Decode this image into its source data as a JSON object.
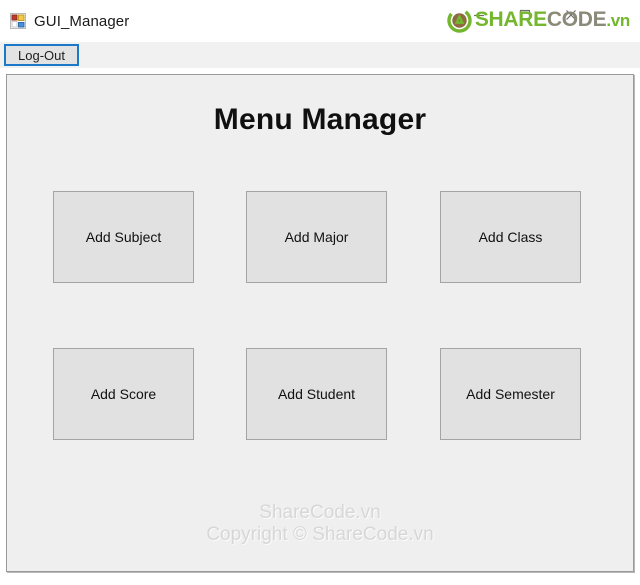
{
  "window": {
    "title": "GUI_Manager",
    "app_icon": "windows-forms-icon",
    "controls": {
      "minimize": "minimize-icon",
      "maximize": "maximize-icon",
      "close": "close-icon"
    }
  },
  "menustrip": {
    "logout_label": "Log-Out"
  },
  "branding": {
    "logo_mark": "sharecode-recycle-logo-icon",
    "text_share": "SHARE",
    "text_code": "CODE",
    "text_vn": ".vn",
    "color_green": "#74b72e",
    "color_gray": "#8a8a7a"
  },
  "main": {
    "heading": "Menu Manager",
    "buttons": [
      {
        "label": "Add Subject"
      },
      {
        "label": "Add Major"
      },
      {
        "label": "Add Class"
      },
      {
        "label": "Add Score"
      },
      {
        "label": "Add Student"
      },
      {
        "label": "Add Semester"
      }
    ],
    "watermark_line1": "ShareCode.vn",
    "watermark_line2": "Copyright © ShareCode.vn"
  }
}
